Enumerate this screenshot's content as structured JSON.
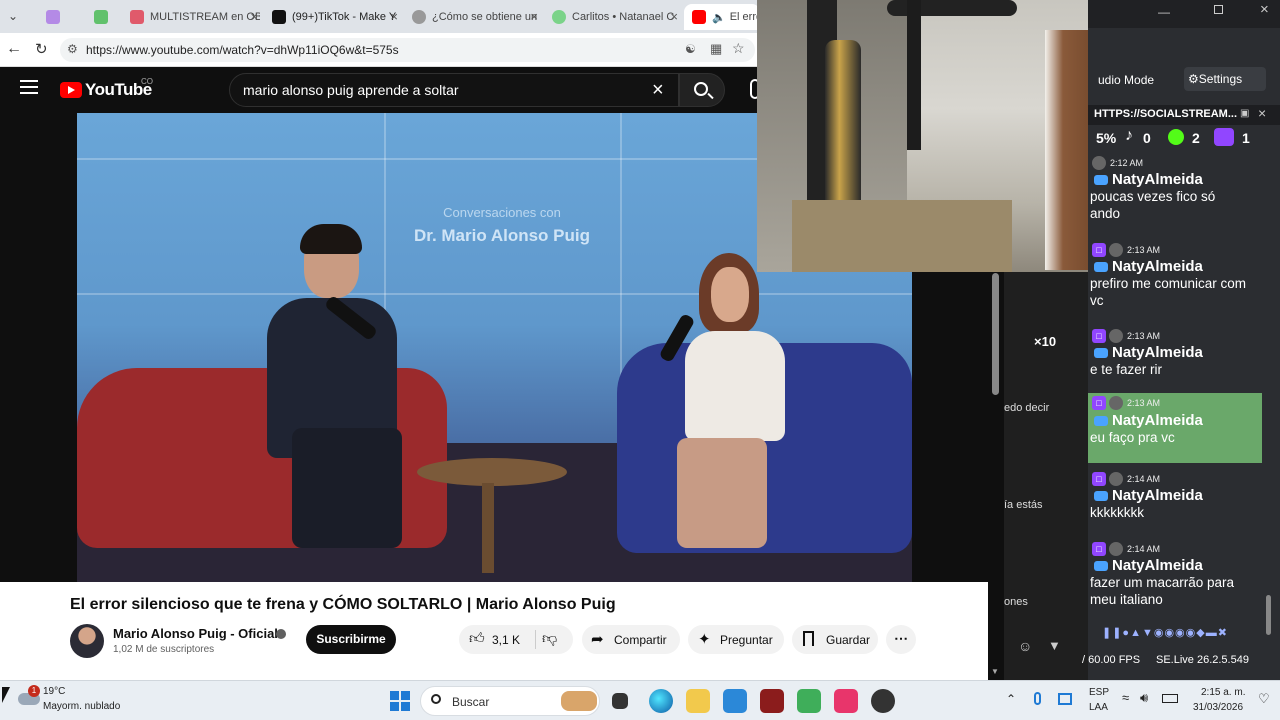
{
  "browser": {
    "tabs": [
      {
        "label": "",
        "color": "#b48ae6"
      },
      {
        "label": "",
        "color": "#61c16c"
      },
      {
        "label": "MULTISTREAM en OB",
        "color": "#e05a6b"
      },
      {
        "label": "(99+)TikTok - Make Y",
        "color": "#111111"
      },
      {
        "label": "¿Cómo se obtiene un",
        "color": "#999999"
      },
      {
        "label": "Carlitos • Natanael C",
        "color": "#7bd389"
      },
      {
        "label": "El error",
        "color": "#ff0000"
      }
    ],
    "url": "https://www.youtube.com/watch?v=dhWp11iOQ6w&t=575s"
  },
  "youtube": {
    "logo": "YouTube",
    "country": "CO",
    "search_value": "mario alonso puig aprende a soltar",
    "video_overlay_line1": "Conversaciones con",
    "video_overlay_line2": "Dr. Mario Alonso Puig",
    "video_title": "El error silencioso que te frena y CÓMO SOLTARLO | Mario Alonso Puig",
    "channel_name": "Mario Alonso Puig - Oficial",
    "subscribers": "1,02 M de suscriptores",
    "subscribe": "Suscribirme",
    "likes": "3,1 K",
    "share": "Compartir",
    "ask": "Preguntar",
    "save": "Guardar",
    "side_fragments": [
      "×10",
      "edo decir",
      "ía estás",
      "ones"
    ]
  },
  "social": {
    "tabs": [
      "udio Mode",
      "Settings"
    ],
    "url": "HTTPS://SOCIALSTREAM...",
    "counts": [
      "5%",
      "0",
      "2",
      "1"
    ],
    "messages": [
      {
        "time": "2:12 AM",
        "user": "NatyAlmeida",
        "text": "poucas vezes fico só\nando",
        "highlight": false
      },
      {
        "time": "2:13 AM",
        "user": "NatyAlmeida",
        "text": "prefiro me comunicar com vc",
        "highlight": false
      },
      {
        "time": "2:13 AM",
        "user": "NatyAlmeida",
        "text": "e te fazer rir",
        "highlight": false
      },
      {
        "time": "2:13 AM",
        "user": "NatyAlmeida",
        "text": "eu faço pra vc",
        "highlight": true
      },
      {
        "time": "2:14 AM",
        "user": "NatyAlmeida",
        "text": "kkkkkkkk",
        "highlight": false
      },
      {
        "time": "2:14 AM",
        "user": "NatyAlmeida",
        "text": "fazer um macarrão para meu italiano",
        "highlight": false
      }
    ],
    "fps": "/ 60.00 FPS",
    "version": "SE.Live 26.2.5.549"
  },
  "taskbar": {
    "weather_temp": "19°C",
    "weather_desc": "Mayorm. nublado",
    "weather_badge": "1",
    "search": "Buscar",
    "lang1": "ESP",
    "lang2": "LAA",
    "time": "2:15 a. m.",
    "date": "31/03/2026"
  }
}
